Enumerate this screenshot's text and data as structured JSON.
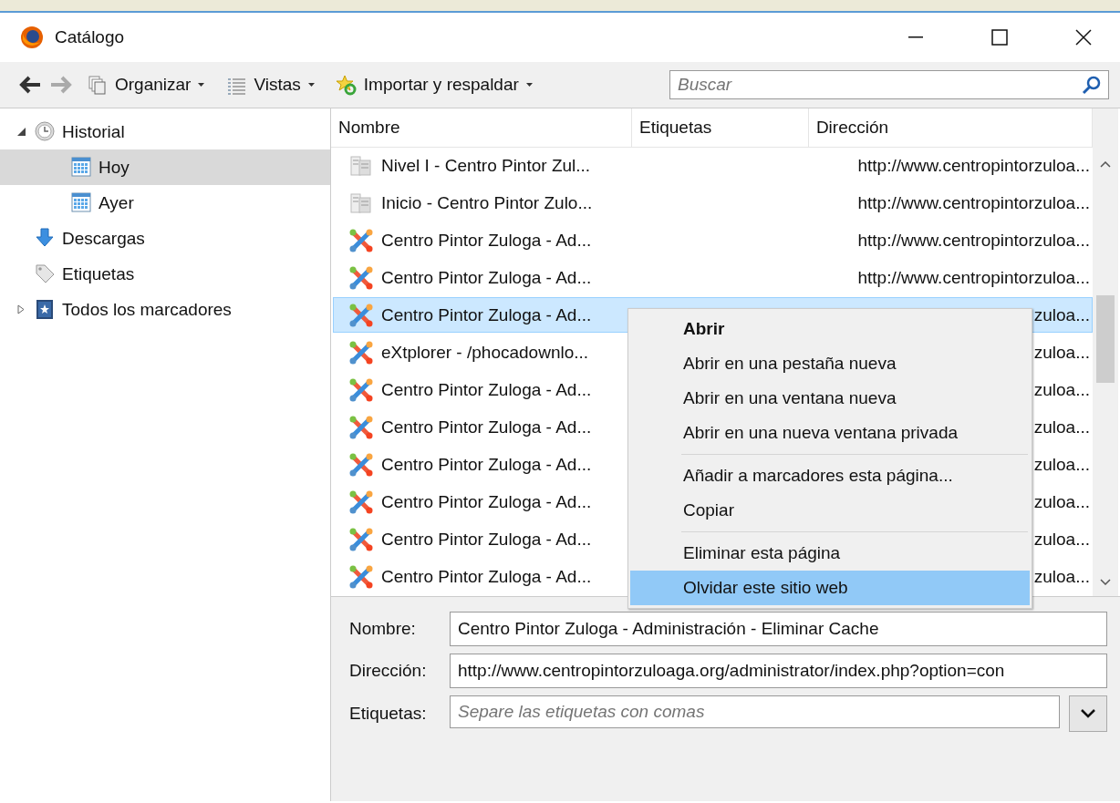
{
  "window": {
    "title": "Catálogo"
  },
  "toolbar": {
    "buttons": [
      {
        "label": "Organizar"
      },
      {
        "label": "Vistas"
      },
      {
        "label": "Importar y respaldar"
      }
    ],
    "search": {
      "placeholder": "Buscar"
    }
  },
  "sidebar": {
    "items": [
      {
        "kind": "history",
        "label": "Historial",
        "expanded": true,
        "selected": false,
        "children": [
          {
            "kind": "day",
            "label": "Hoy",
            "selected": true
          },
          {
            "kind": "day",
            "label": "Ayer",
            "selected": false
          }
        ]
      },
      {
        "kind": "downloads",
        "label": "Descargas",
        "selected": false
      },
      {
        "kind": "tags",
        "label": "Etiquetas",
        "selected": false
      },
      {
        "kind": "bookmarks",
        "label": "Todos los marcadores",
        "expanded": false,
        "selected": false
      }
    ]
  },
  "table": {
    "columns": [
      "Nombre",
      "Etiquetas",
      "Dirección"
    ],
    "rows": [
      {
        "kind": "page",
        "name": "Nivel I - Centro Pintor Zul...",
        "address": "http://www.centropintorzuloa...",
        "selected": false
      },
      {
        "kind": "page",
        "name": "Inicio - Centro Pintor Zulo...",
        "address": "http://www.centropintorzuloa...",
        "selected": false
      },
      {
        "kind": "joomla",
        "name": "Centro Pintor Zuloga - Ad...",
        "address": "http://www.centropintorzuloa...",
        "selected": false
      },
      {
        "kind": "joomla",
        "name": "Centro Pintor Zuloga - Ad...",
        "address": "http://www.centropintorzuloa...",
        "selected": false
      },
      {
        "kind": "joomla",
        "name": "Centro Pintor Zuloga - Ad...",
        "address": "zuloa...",
        "selected": true
      },
      {
        "kind": "joomla",
        "name": "eXtplorer - /phocadownlo...",
        "address": "zuloa...",
        "selected": false
      },
      {
        "kind": "joomla",
        "name": "Centro Pintor Zuloga - Ad...",
        "address": "zuloa...",
        "selected": false
      },
      {
        "kind": "joomla",
        "name": "Centro Pintor Zuloga - Ad...",
        "address": "zuloa...",
        "selected": false
      },
      {
        "kind": "joomla",
        "name": "Centro Pintor Zuloga - Ad...",
        "address": "zuloa...",
        "selected": false
      },
      {
        "kind": "joomla",
        "name": "Centro Pintor Zuloga - Ad...",
        "address": "zuloa...",
        "selected": false
      },
      {
        "kind": "joomla",
        "name": "Centro Pintor Zuloga - Ad...",
        "address": "zuloa...",
        "selected": false
      },
      {
        "kind": "joomla",
        "name": "Centro Pintor Zuloga - Ad...",
        "address": "zuloa...",
        "selected": false
      }
    ]
  },
  "context_menu": {
    "items": [
      {
        "kind": "item",
        "label": "Abrir",
        "default": true,
        "selected": false
      },
      {
        "kind": "item",
        "label": "Abrir en una pestaña nueva",
        "default": false,
        "selected": false
      },
      {
        "kind": "item",
        "label": "Abrir en una ventana nueva",
        "default": false,
        "selected": false
      },
      {
        "kind": "item",
        "label": "Abrir en una nueva ventana privada",
        "default": false,
        "selected": false
      },
      {
        "kind": "separator"
      },
      {
        "kind": "item",
        "label": "Añadir a marcadores esta página...",
        "default": false,
        "selected": false
      },
      {
        "kind": "item",
        "label": "Copiar",
        "default": false,
        "selected": false
      },
      {
        "kind": "separator"
      },
      {
        "kind": "item",
        "label": "Eliminar esta página",
        "default": false,
        "selected": false
      },
      {
        "kind": "item",
        "label": "Olvidar este sitio web",
        "default": false,
        "selected": true
      }
    ]
  },
  "details": {
    "fields": [
      {
        "kind": "text",
        "label": "Nombre:",
        "value": "Centro Pintor Zuloga - Administración - Eliminar Cache"
      },
      {
        "kind": "text",
        "label": "Dirección:",
        "value": "http://www.centropintorzuloaga.org/administrator/index.php?option=con"
      },
      {
        "kind": "tags",
        "label": "Etiquetas:",
        "placeholder": "Separe las etiquetas con comas"
      }
    ]
  }
}
